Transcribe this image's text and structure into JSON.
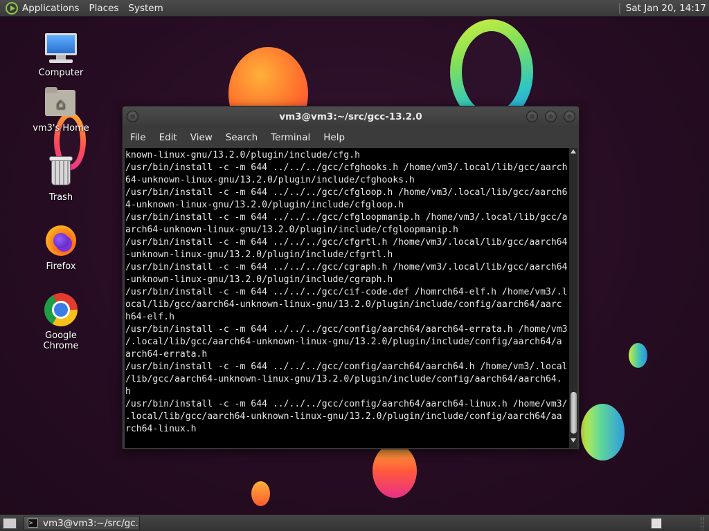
{
  "top_panel": {
    "menus": [
      "Applications",
      "Places",
      "System"
    ],
    "clock": "Sat Jan 20, 14:17"
  },
  "desktop_icons": [
    {
      "label": "Computer",
      "icon": "computer-icon"
    },
    {
      "label": "vm3's Home",
      "icon": "home-folder-icon"
    },
    {
      "label": "Trash",
      "icon": "trash-icon"
    },
    {
      "label": "Firefox",
      "icon": "firefox-icon"
    },
    {
      "label": "Google Chrome",
      "icon": "chrome-icon"
    }
  ],
  "terminal": {
    "title": "vm3@vm3:~/src/gcc-13.2.0",
    "menus": [
      "File",
      "Edit",
      "View",
      "Search",
      "Terminal",
      "Help"
    ],
    "lines": [
      "known-linux-gnu/13.2.0/plugin/include/cfg.h",
      "/usr/bin/install -c -m 644 ../../../gcc/cfghooks.h /home/vm3/.local/lib/gcc/aarch",
      "64-unknown-linux-gnu/13.2.0/plugin/include/cfghooks.h",
      "/usr/bin/install -c -m 644 ../../../gcc/cfgloop.h /home/vm3/.local/lib/gcc/aarch6",
      "4-unknown-linux-gnu/13.2.0/plugin/include/cfgloop.h",
      "/usr/bin/install -c -m 644 ../../../gcc/cfgloopmanip.h /home/vm3/.local/lib/gcc/a",
      "arch64-unknown-linux-gnu/13.2.0/plugin/include/cfgloopmanip.h",
      "/usr/bin/install -c -m 644 ../../../gcc/cfgrtl.h /home/vm3/.local/lib/gcc/aarch64",
      "-unknown-linux-gnu/13.2.0/plugin/include/cfgrtl.h",
      "/usr/bin/install -c -m 644 ../../../gcc/cgraph.h /home/vm3/.local/lib/gcc/aarch64",
      "-unknown-linux-gnu/13.2.0/plugin/include/cgraph.h",
      "/usr/bin/install -c -m 644 ../../../gcc/cif-code.def /homrch64-elf.h /home/vm3/.l",
      "ocal/lib/gcc/aarch64-unknown-linux-gnu/13.2.0/plugin/include/config/aarch64/aarc",
      "h64-elf.h",
      "/usr/bin/install -c -m 644 ../../../gcc/config/aarch64/aarch64-errata.h /home/vm3",
      "/.local/lib/gcc/aarch64-unknown-linux-gnu/13.2.0/plugin/include/config/aarch64/a",
      "arch64-errata.h",
      "/usr/bin/install -c -m 644 ../../../gcc/config/aarch64/aarch64.h /home/vm3/.local",
      "/lib/gcc/aarch64-unknown-linux-gnu/13.2.0/plugin/include/config/aarch64/aarch64.",
      "h",
      "/usr/bin/install -c -m 644 ../../../gcc/config/aarch64/aarch64-linux.h /home/vm3/",
      ".local/lib/gcc/aarch64-unknown-linux-gnu/13.2.0/plugin/include/config/aarch64/aa",
      "rch64-linux.h"
    ]
  },
  "taskbar": {
    "window_button": "vm3@vm3:~/src/gc..."
  }
}
